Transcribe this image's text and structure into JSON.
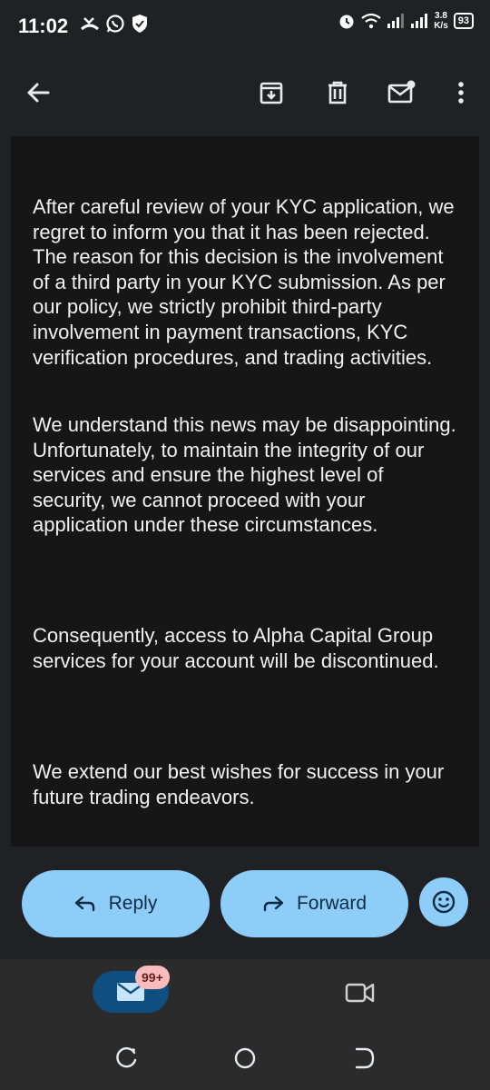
{
  "status_bar": {
    "time": "11:02",
    "net_speed_value": "3.8",
    "net_speed_unit": "K/s",
    "battery": "93"
  },
  "toolbar": {
    "back_icon": "arrow-left-icon",
    "archive_icon": "archive-icon",
    "delete_icon": "trash-icon",
    "mark_unread_icon": "mail-unread-icon",
    "more_icon": "more-vertical-icon"
  },
  "message": {
    "paragraphs": [
      "After careful review of your KYC application, we regret to inform you that it has been rejected. The reason for this decision is the involvement of a third party in your KYC submission. As per our policy, we strictly prohibit third-party involvement in payment transactions, KYC verification procedures, and trading activities.",
      "We understand this news may be disappointing. Unfortunately, to maintain the integrity of our services and ensure the highest level of security, we cannot proceed with your application under these circumstances.",
      "Consequently, access to Alpha Capital Group services for your account will be discontinued.",
      "We extend our best wishes for success in your future trading endeavors."
    ]
  },
  "actions": {
    "reply_label": "Reply",
    "forward_label": "Forward",
    "emoji_icon": "emoji-smile-icon"
  },
  "app_nav": {
    "mail_badge": "99+",
    "mail_icon": "mail-icon",
    "video_icon": "video-camera-icon"
  },
  "colors": {
    "background": "#202124",
    "message_background": "#161616",
    "button_fill": "#8ecdf8",
    "mail_pill": "#0f4f80",
    "badge": "#f8bcbc"
  }
}
